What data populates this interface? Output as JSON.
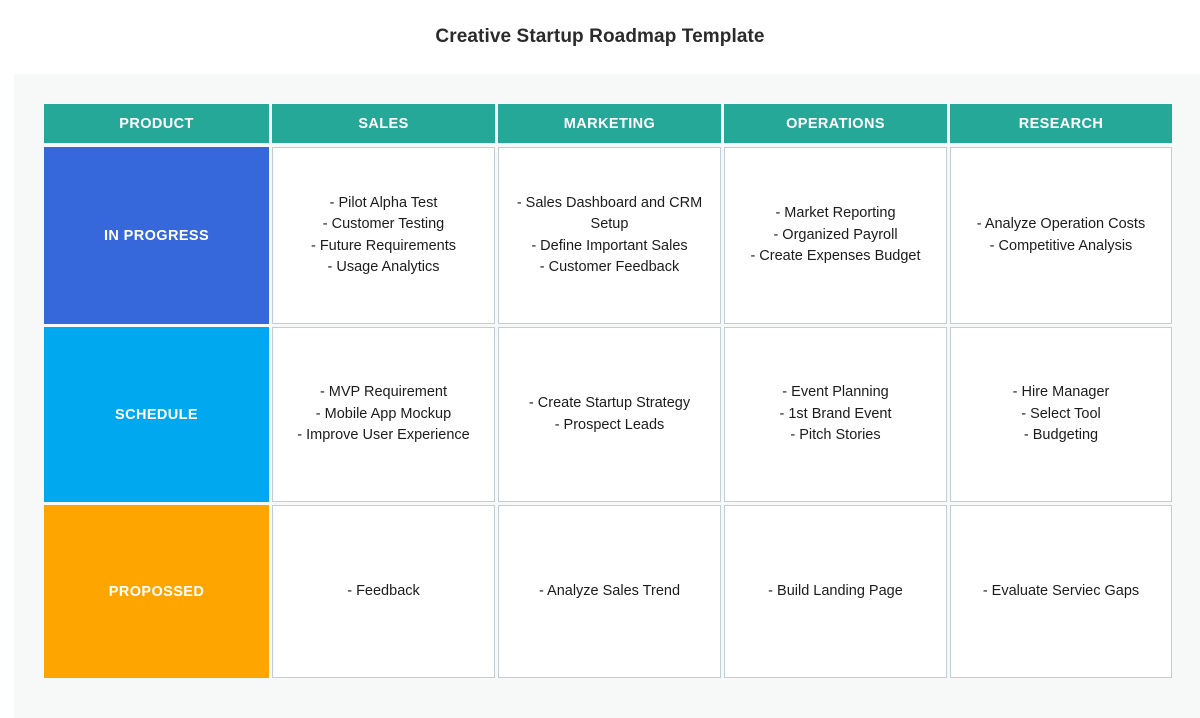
{
  "page": {
    "title": "Creative Startup Roadmap Template",
    "background": "#ffffff",
    "panel_background": "#f7f8f8"
  },
  "colors": {
    "header_teal": "#26a898",
    "in_progress_blue": "#3668dc",
    "schedule_cyan": "#00a8f0",
    "proposed_orange": "#ffa500",
    "cell_border": "#c2ced6",
    "cell_background": "#ffffff",
    "header_text": "#ffffff",
    "body_text": "#1c1c1c"
  },
  "table": {
    "columns": [
      {
        "label": "PRODUCT"
      },
      {
        "label": "SALES"
      },
      {
        "label": "MARKETING"
      },
      {
        "label": "OPERATIONS"
      },
      {
        "label": "RESEARCH"
      }
    ],
    "rows": [
      {
        "status_label": "IN PROGRESS",
        "status_color": "#3668dc",
        "cells": [
          {
            "column": "SALES",
            "lines": [
              "- Pilot Alpha Test",
              "- Customer Testing",
              "- Future Requirements",
              "- Usage Analytics"
            ]
          },
          {
            "column": "MARKETING",
            "lines": [
              "- Sales Dashboard and CRM Setup",
              "- Define Important Sales",
              "- Customer Feedback"
            ]
          },
          {
            "column": "OPERATIONS",
            "lines": [
              "- Market Reporting",
              "- Organized Payroll",
              "- Create Expenses Budget"
            ]
          },
          {
            "column": "RESEARCH",
            "lines": [
              "- Analyze Operation Costs",
              "- Competitive Analysis"
            ]
          }
        ]
      },
      {
        "status_label": "SCHEDULE",
        "status_color": "#00a8f0",
        "cells": [
          {
            "column": "SALES",
            "lines": [
              "- MVP Requirement",
              "- Mobile App Mockup",
              "- Improve User Experience"
            ]
          },
          {
            "column": "MARKETING",
            "lines": [
              "- Create Startup Strategy",
              "- Prospect Leads"
            ]
          },
          {
            "column": "OPERATIONS",
            "lines": [
              "- Event Planning",
              "- 1st Brand Event",
              "- Pitch Stories"
            ]
          },
          {
            "column": "RESEARCH",
            "lines": [
              "- Hire Manager",
              "- Select Tool",
              "- Budgeting"
            ]
          }
        ]
      },
      {
        "status_label": "PROPOSSED",
        "status_color": "#ffa500",
        "cells": [
          {
            "column": "SALES",
            "lines": [
              "- Feedback"
            ]
          },
          {
            "column": "MARKETING",
            "lines": [
              "- Analyze Sales Trend"
            ]
          },
          {
            "column": "OPERATIONS",
            "lines": [
              "- Build Landing Page"
            ]
          },
          {
            "column": "RESEARCH",
            "lines": [
              "- Evaluate Serviec Gaps"
            ]
          }
        ]
      }
    ]
  }
}
